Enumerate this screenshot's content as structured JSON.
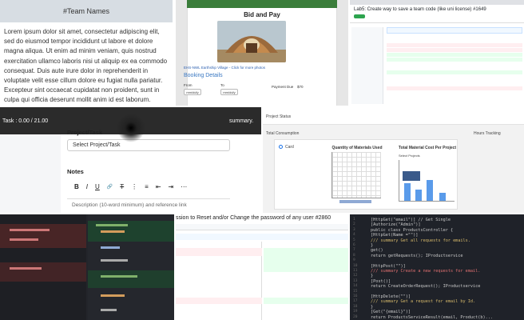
{
  "tile1": {
    "header": "#Team Names",
    "body": "Lorem ipsum dolor sit amet, consectetur adipiscing elit, sed do eiusmod tempor incididunt ut labore et dolore magna aliqua. Ut enim ad minim veniam, quis nostrud exercitation ullamco laboris nisi ut aliquip ex ea commodo consequat. Duis aute irure dolor in reprehenderit in voluptate velit esse cillum dolore eu fugiat nulla pariatur. Excepteur sint occaecat cupidatat non proident, sunt in culpa qui officia deserunt mollit anim id est laborum."
  },
  "tile2": {
    "title": "Bid and Pay",
    "caption": "EHS-NWL Earthship Village - Click for more photos",
    "booking_title": "Booking Details",
    "from_label": "From",
    "to_label": "To",
    "payment_label": "Payment Due",
    "payment_value": "$70",
    "from_value": "mm/dd/y",
    "to_value": "mm/dd/y"
  },
  "tile3": {
    "title": "Lab5: Create way to save a team code (like uni license) #1649"
  },
  "tile4": {
    "task_text": "Task : 0.00 / 21.00",
    "summary_text": "summary.",
    "project_label": "Project/Task",
    "select_placeholder": "Select Project/Task",
    "notes_label": "Notes",
    "toolbar": [
      "B",
      "I",
      "U",
      "🔗",
      "T",
      "⋮",
      "≡",
      "⇤",
      "⇥",
      "⋯"
    ],
    "description_placeholder": "Description (10-word minimum) and reference link"
  },
  "tile5": {
    "heading": "Project Status",
    "sub": "Total Consumption",
    "right": "Hours Tracking",
    "chart1_title": "Quantity of Materials Used",
    "chart2_title": "Total Material Cost Per Project",
    "filter": "Select Projects",
    "card_label": "Card"
  },
  "tile7": {
    "title": "ssion to Reset and/or Change the password of any user #2860"
  },
  "tile8": {
    "lines": [
      {
        "n": "1",
        "t": "[HttpGet(\"email\")] // Get Single",
        "c": "#c8c8c8"
      },
      {
        "n": "2",
        "t": "[Authorize(\"Admin\")]",
        "c": "#c8c8c8"
      },
      {
        "n": "3",
        "t": "public class ProductsController {",
        "c": "#c8c8c8"
      },
      {
        "n": "4",
        "t": "  [HttpGet(Name =\"\")]",
        "c": "#c8c8c8"
      },
      {
        "n": "5",
        "t": "  /// summary   Get all requests for emails.",
        "c": "#d5b86a"
      },
      {
        "n": "6",
        "t": "  }",
        "c": "#c8c8c8"
      },
      {
        "n": "7",
        "t": "  get()",
        "c": "#c8c8c8"
      },
      {
        "n": "8",
        "t": "  return getRequests(); IProductservice",
        "c": "#c8c8c8"
      },
      {
        "n": "9",
        "t": "",
        "c": "#c8c8c8"
      },
      {
        "n": "10",
        "t": "  [HttpPost(\"\")]",
        "c": "#c8c8c8"
      },
      {
        "n": "11",
        "t": "  /// summary   Create a new requests for email.",
        "c": "#e07070"
      },
      {
        "n": "12",
        "t": "  }",
        "c": "#c8c8c8"
      },
      {
        "n": "13",
        "t": "  [Post()]",
        "c": "#c8c8c8"
      },
      {
        "n": "14",
        "t": "  return CreateOrderRequest(); IProductservice",
        "c": "#c8c8c8"
      },
      {
        "n": "15",
        "t": "",
        "c": "#c8c8c8"
      },
      {
        "n": "16",
        "t": "  [HttpDelete(\"\")]",
        "c": "#c8c8c8"
      },
      {
        "n": "17",
        "t": "  /// summary   Get a request for email by Id.",
        "c": "#d5b86a"
      },
      {
        "n": "18",
        "t": "  }",
        "c": "#c8c8c8"
      },
      {
        "n": "19",
        "t": "  [Get(\"{email}\")]",
        "c": "#c8c8c8"
      },
      {
        "n": "20",
        "t": "  return ProductsServiceResult(email, Product(b)...",
        "c": "#c8c8c8"
      }
    ]
  }
}
